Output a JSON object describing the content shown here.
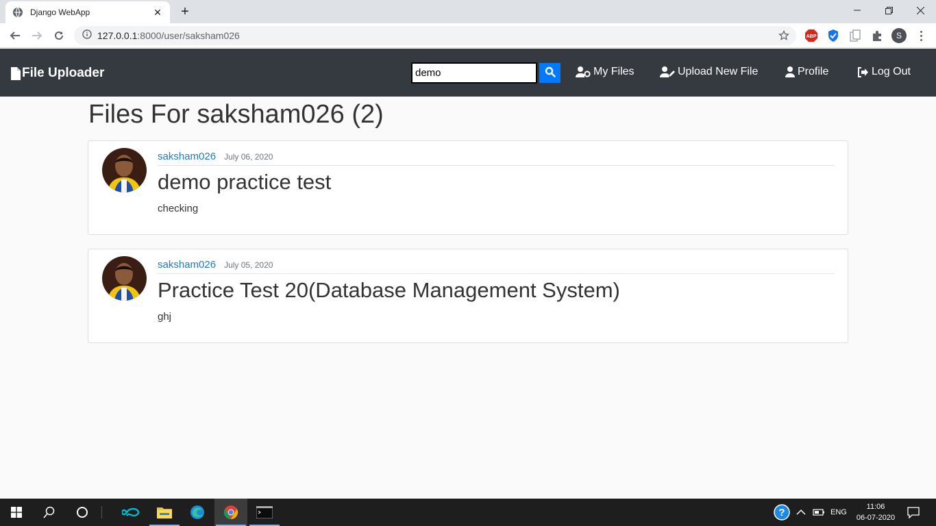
{
  "browser": {
    "tab_title": "Django WebApp",
    "url_host": "127.0.0.1",
    "url_path": ":8000/user/saksham026",
    "profile_initial": "S",
    "ext_abp_label": "ABP"
  },
  "navbar": {
    "brand": "File Uploader",
    "search_value": "demo",
    "links": {
      "my_files": "My Files",
      "upload": "Upload New File",
      "profile": "Profile",
      "logout": "Log Out"
    }
  },
  "page": {
    "title": "Files For saksham026 (2)"
  },
  "posts": [
    {
      "author": "saksham026",
      "date": "July 06, 2020",
      "title": "demo practice test",
      "description": "checking"
    },
    {
      "author": "saksham026",
      "date": "July 05, 2020",
      "title": "Practice Test 20(Database Management System)",
      "description": "ghj"
    }
  ],
  "taskbar": {
    "language": "ENG",
    "time": "11:06",
    "date": "06-07-2020"
  },
  "colors": {
    "navbar_bg": "#343a40",
    "accent": "#007bff",
    "link": "#1f7bc9"
  }
}
